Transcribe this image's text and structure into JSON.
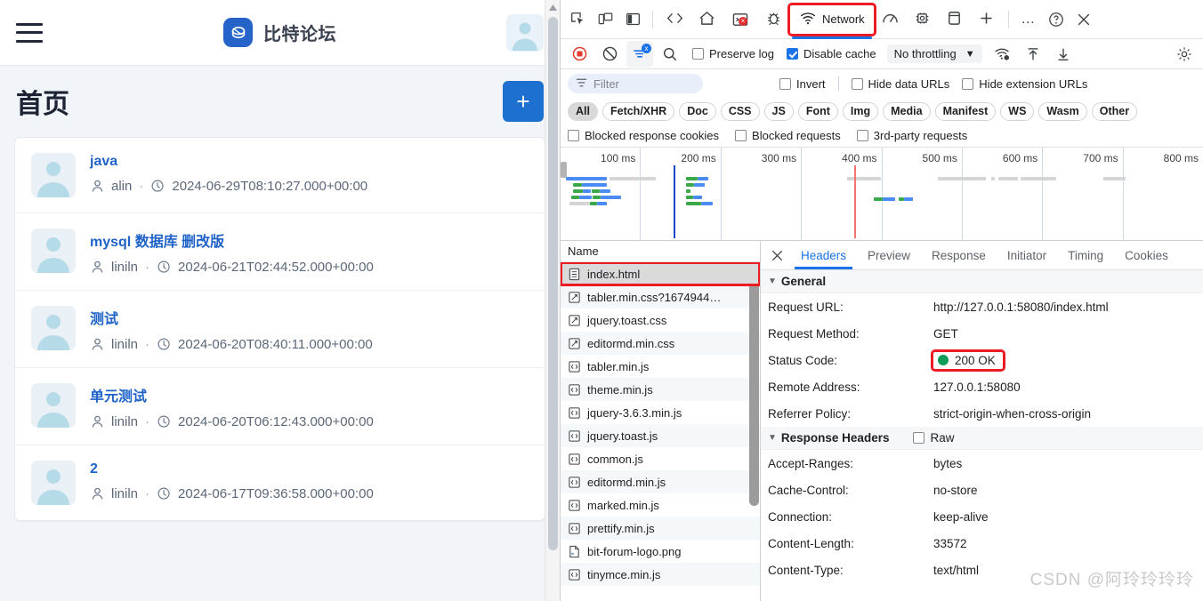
{
  "webpage": {
    "header": {
      "menu_icon": "hamburger-icon",
      "brand": "比特论坛",
      "avatar_icon": "user-avatar-icon"
    },
    "title": "首页",
    "add_button_label": "+",
    "posts": [
      {
        "title": "java",
        "author": "alin",
        "separator": "·",
        "date": "2024-06-29T08:10:27.000+00:00"
      },
      {
        "title": "mysql 数据库 删改版",
        "author": "liniln",
        "separator": "·",
        "date": "2024-06-21T02:44:52.000+00:00"
      },
      {
        "title": "测试",
        "author": "liniln",
        "separator": "·",
        "date": "2024-06-20T08:40:11.000+00:00"
      },
      {
        "title": "单元测试",
        "author": "liniln",
        "separator": "·",
        "date": "2024-06-20T06:12:43.000+00:00"
      },
      {
        "title": "2",
        "author": "liniln",
        "separator": "·",
        "date": "2024-06-17T09:36:58.000+00:00"
      }
    ]
  },
  "devtools": {
    "toolbar": {
      "icons": [
        "inspect-element-icon",
        "device-toolbar-icon",
        "dock-side-icon"
      ],
      "panels": [
        {
          "label": "",
          "icon": "elements-code-icon",
          "selected": false
        },
        {
          "label": "",
          "icon": "home-icon",
          "selected": false
        },
        {
          "label": "",
          "icon": "console-icon",
          "selected": false,
          "error_badge": "x"
        },
        {
          "label": "",
          "icon": "debugger-bug-icon",
          "selected": false
        },
        {
          "label": "Network",
          "icon": "network-wifi-icon",
          "selected": true,
          "highlighted": true
        },
        {
          "label": "",
          "icon": "performance-icon",
          "selected": false
        },
        {
          "label": "",
          "icon": "memory-chip-icon",
          "selected": false
        },
        {
          "label": "",
          "icon": "application-icon",
          "selected": false
        },
        {
          "label": "",
          "icon": "add-panel-icon",
          "selected": false
        }
      ],
      "more_label": "…",
      "help_icon": "help-question-icon",
      "close_icon": "close-icon"
    },
    "controls": {
      "record_icon": "record-stop-icon",
      "clear_icon": "clear-circle-slash-icon",
      "filter_toggle_icon": "filter-settings-icon",
      "search_icon": "search-icon",
      "preserve_log": {
        "label": "Preserve log",
        "checked": false
      },
      "disable_cache": {
        "label": "Disable cache",
        "checked": true
      },
      "throttling": {
        "value": "No throttling",
        "caret": "▼"
      },
      "network_conditions_icon": "network-conditions-icon",
      "import_icon": "import-arrow-up-icon",
      "export_icon": "export-arrow-down-icon",
      "settings_icon": "settings-gear-icon"
    },
    "filterbar": {
      "filter_placeholder": "Filter",
      "filter_icon": "filter-icon",
      "invert": {
        "label": "Invert",
        "checked": false
      },
      "hide_data_urls": {
        "label": "Hide data URLs",
        "checked": false
      },
      "hide_extension_urls": {
        "label": "Hide extension URLs",
        "checked": false
      }
    },
    "resource_types": [
      {
        "label": "All",
        "active": true
      },
      {
        "label": "Fetch/XHR",
        "active": false
      },
      {
        "label": "Doc",
        "active": false
      },
      {
        "label": "CSS",
        "active": false
      },
      {
        "label": "JS",
        "active": false
      },
      {
        "label": "Font",
        "active": false
      },
      {
        "label": "Img",
        "active": false
      },
      {
        "label": "Media",
        "active": false
      },
      {
        "label": "Manifest",
        "active": false
      },
      {
        "label": "WS",
        "active": false
      },
      {
        "label": "Wasm",
        "active": false
      },
      {
        "label": "Other",
        "active": false
      }
    ],
    "blocked_filters": [
      {
        "label": "Blocked response cookies",
        "checked": false
      },
      {
        "label": "Blocked requests",
        "checked": false
      },
      {
        "label": "3rd-party requests",
        "checked": false
      }
    ],
    "overview": {
      "ticks": [
        "100 ms",
        "200 ms",
        "300 ms",
        "400 ms",
        "500 ms",
        "600 ms",
        "700 ms",
        "800 ms"
      ],
      "dom_content_loaded_color": "#1b46c9",
      "load_event_color": "#f0776c"
    },
    "requests": {
      "column_header": "Name",
      "rows": [
        {
          "name": "index.html",
          "type": "doc",
          "selected": true,
          "highlighted": true
        },
        {
          "name": "tabler.min.css?1674944…",
          "type": "css",
          "selected": false,
          "highlighted": false
        },
        {
          "name": "jquery.toast.css",
          "type": "css",
          "selected": false,
          "highlighted": false
        },
        {
          "name": "editormd.min.css",
          "type": "css",
          "selected": false,
          "highlighted": false
        },
        {
          "name": "tabler.min.js",
          "type": "js",
          "selected": false,
          "highlighted": false
        },
        {
          "name": "theme.min.js",
          "type": "js",
          "selected": false,
          "highlighted": false
        },
        {
          "name": "jquery-3.6.3.min.js",
          "type": "js",
          "selected": false,
          "highlighted": false
        },
        {
          "name": "jquery.toast.js",
          "type": "js",
          "selected": false,
          "highlighted": false
        },
        {
          "name": "common.js",
          "type": "js",
          "selected": false,
          "highlighted": false
        },
        {
          "name": "editormd.min.js",
          "type": "js",
          "selected": false,
          "highlighted": false
        },
        {
          "name": "marked.min.js",
          "type": "js",
          "selected": false,
          "highlighted": false
        },
        {
          "name": "prettify.min.js",
          "type": "js",
          "selected": false,
          "highlighted": false
        },
        {
          "name": "bit-forum-logo.png",
          "type": "img",
          "selected": false,
          "highlighted": false
        },
        {
          "name": "tinymce.min.js",
          "type": "js",
          "selected": false,
          "highlighted": false
        }
      ]
    },
    "details": {
      "close_icon": "close-icon",
      "tabs": [
        {
          "label": "Headers",
          "selected": true
        },
        {
          "label": "Preview",
          "selected": false
        },
        {
          "label": "Response",
          "selected": false
        },
        {
          "label": "Initiator",
          "selected": false
        },
        {
          "label": "Timing",
          "selected": false
        },
        {
          "label": "Cookies",
          "selected": false
        }
      ],
      "general": {
        "section_title": "General",
        "caret": "▼",
        "rows": [
          {
            "key": "Request URL:",
            "value": "http://127.0.0.1:58080/index.html"
          },
          {
            "key": "Request Method:",
            "value": "GET"
          },
          {
            "key": "Status Code:",
            "value": "200 OK",
            "status_dot": "#0f9d58",
            "highlighted": true
          },
          {
            "key": "Remote Address:",
            "value": "127.0.0.1:58080"
          },
          {
            "key": "Referrer Policy:",
            "value": "strict-origin-when-cross-origin"
          }
        ]
      },
      "response_headers": {
        "section_title": "Response Headers",
        "caret": "▼",
        "raw_label": "Raw",
        "raw_checked": false,
        "rows": [
          {
            "key": "Accept-Ranges:",
            "value": "bytes"
          },
          {
            "key": "Cache-Control:",
            "value": "no-store"
          },
          {
            "key": "Connection:",
            "value": "keep-alive"
          },
          {
            "key": "Content-Length:",
            "value": "33572"
          },
          {
            "key": "Content-Type:",
            "value": "text/html"
          }
        ]
      }
    }
  },
  "watermark": "CSDN @阿玲玲玲玲",
  "colors": {
    "accent_blue": "#1a73e8",
    "brand_blue": "#2563c9",
    "highlight_red": "#ed1c24",
    "status_green": "#0f9d58"
  }
}
